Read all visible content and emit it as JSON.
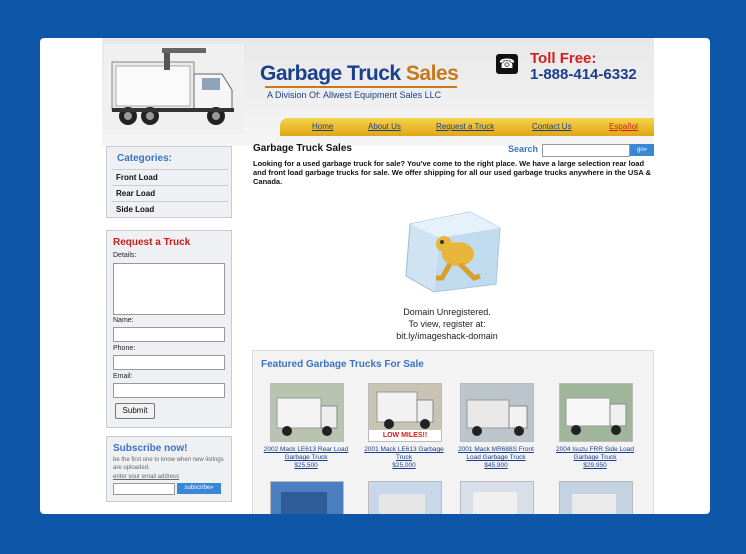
{
  "header": {
    "logo_main": "Garbage Truck",
    "logo_sales": "Sales",
    "logo_sub": "A Division Of: Allwest Equipment Sales LLC",
    "toll_label": "Toll Free:",
    "toll_number": "1-888-414-6332"
  },
  "nav": [
    "Home",
    "About Us",
    "Request a Truck",
    "Contact Us",
    "Español"
  ],
  "categories": {
    "title": "Categories:",
    "items": [
      "Front Load",
      "Rear Load",
      "Side Load"
    ]
  },
  "request": {
    "title": "Request a Truck",
    "details_label": "Details:",
    "name_label": "Name:",
    "phone_label": "Phone:",
    "email_label": "Email:",
    "submit_label": "Submit"
  },
  "subscribe": {
    "title": "Subscribe now!",
    "text": "be the first one to know when new listings are uploaded.",
    "link": "enter your email address",
    "button": "subscribe»"
  },
  "main": {
    "title": "Garbage Truck Sales",
    "search_label": "Search",
    "go_label": "go»",
    "intro": "Looking for a used garbage truck for sale?  You've come to the right place.  We have a large selection rear load and front load garbage trucks for sale.  We offer shipping for all our used garbage trucks anywhere in the USA & Canada."
  },
  "placeholder_image": {
    "line1": "Domain Unregistered.",
    "line2": "To view, register at:",
    "line3": "bit.ly/imageshack-domain"
  },
  "featured": {
    "title": "Featured Garbage Trucks For Sale",
    "items": [
      {
        "name": "2002 Mack LE613 Rear Load Garbage Truck",
        "price": "$25,500",
        "badge": ""
      },
      {
        "name": "2001 Mack LE613 Garbage Truck",
        "price": "$25,000",
        "badge": "LOW MILES!!"
      },
      {
        "name": "2001 Mack MR688S Front Load Garbage Truck",
        "price": "$45,900",
        "badge": ""
      },
      {
        "name": "2004 Isuzu FRR Side Load Garbage Truck",
        "price": "$29,950",
        "badge": ""
      }
    ]
  },
  "colors": {
    "frame": "#0d56a8",
    "brand_blue": "#1c3f8c",
    "brand_orange": "#c8781b",
    "nav_gold": "#e0a515",
    "link_blue": "#3a73c4",
    "alert_red": "#c41e1e"
  }
}
